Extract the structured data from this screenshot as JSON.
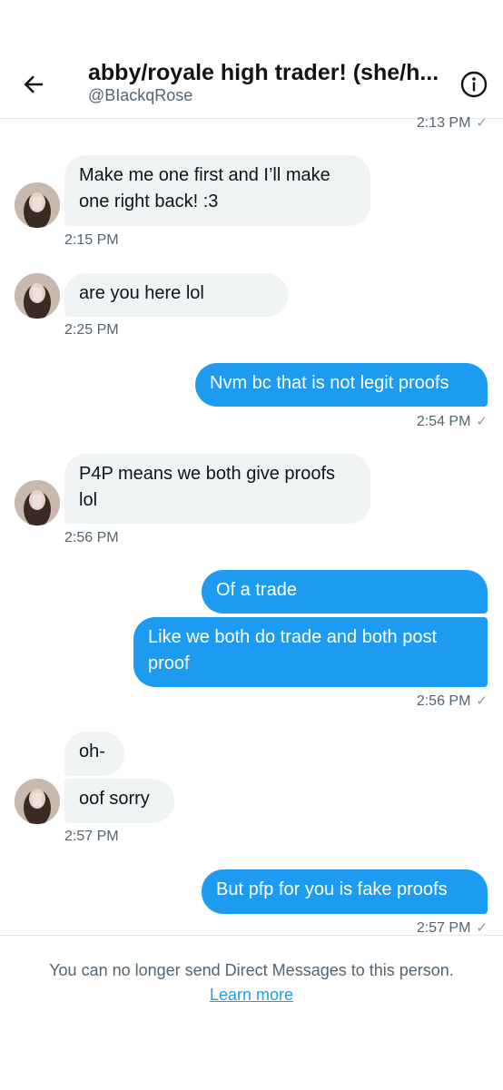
{
  "header": {
    "title": "abby/royale high trader! (she/h...",
    "handle": "@BIackqRose"
  },
  "messages": {
    "top_time": "2:13 PM",
    "m1": "Make me one first and I’ll make one right back! :3",
    "m1_time": "2:15 PM",
    "m2": "are you here lol",
    "m2_time": "2:25 PM",
    "m3": "Nvm bc that is not legit proofs",
    "m3_time": "2:54 PM",
    "m4": "P4P means we both give proofs lol",
    "m4_time": "2:56 PM",
    "m5": "Of a trade",
    "m6": "Like we both do trade and both post proof",
    "m6_time": "2:56 PM",
    "m7": "oh-",
    "m8": "oof sorry",
    "m8_time": "2:57 PM",
    "m9": "But pfp for you is fake proofs",
    "m9_time": "2:57 PM",
    "check_glyph": "✓"
  },
  "footer": {
    "notice": "You can no longer send Direct Messages to this person.",
    "learn_more": "Learn more"
  },
  "colors": {
    "accent": "#1d9bf0",
    "incoming_bubble": "#eff3f4",
    "secondary_text": "#536471"
  }
}
